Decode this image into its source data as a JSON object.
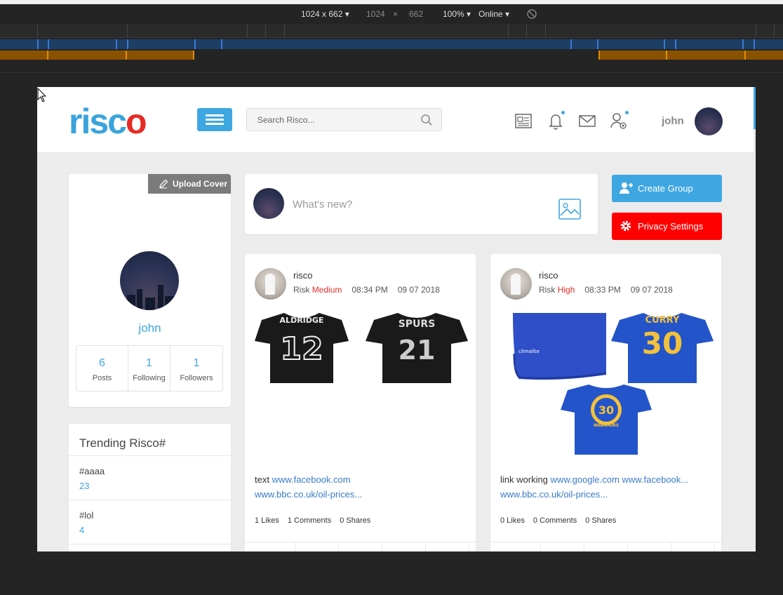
{
  "devtools": {
    "device": "1024 x 662",
    "width": "1024",
    "times": "×",
    "height": "662",
    "zoom": "100%",
    "network": "Online"
  },
  "header": {
    "logo_main": "risc",
    "logo_o": "o",
    "search_placeholder": "Search Risco...",
    "username": "john",
    "icons": [
      "news-icon",
      "bell-icon",
      "mail-icon",
      "add-user-icon"
    ]
  },
  "profile": {
    "upload_cover": "Upload Cover",
    "name": "john",
    "stats": [
      {
        "value": "6",
        "label": "Posts"
      },
      {
        "value": "1",
        "label": "Following"
      },
      {
        "value": "1",
        "label": "Followers"
      }
    ]
  },
  "trending": {
    "title": "Trending Risco#",
    "items": [
      {
        "tag": "#aaaa",
        "count": "23"
      },
      {
        "tag": "#lol",
        "count": "4"
      }
    ]
  },
  "composer": {
    "placeholder": "What's new?"
  },
  "actions": {
    "create_group": "Create Group",
    "privacy_settings": "Privacy Settings",
    "colors": {
      "create": "#3ea7e1",
      "privacy": "#ff0000"
    }
  },
  "posts": [
    {
      "author": "risco",
      "risk_label": "Risk",
      "risk_value": "Medium",
      "time": "08:34 PM",
      "date": "09 07 2018",
      "text": "text",
      "link1": "www.facebook.com",
      "link2": "www.bbc.co.uk/oil-prices...",
      "likes": "1 Likes",
      "comments": "1 Comments",
      "shares": "0 Shares",
      "images": [
        {
          "name": "ALDRIDGE",
          "number": "12"
        },
        {
          "name": "SPURS",
          "number": "21"
        }
      ]
    },
    {
      "author": "risco",
      "risk_label": "Risk",
      "risk_value": "High",
      "time": "08:33 PM",
      "date": "09 07 2018",
      "text": "link working",
      "link1": "www.google.com",
      "link2": "www.facebook...",
      "link3": "www.bbc.co.uk/oil-prices...",
      "likes": "0 Likes",
      "comments": "0 Comments",
      "shares": "0 Shares",
      "images": [
        {
          "name": "climalite",
          "number": ""
        },
        {
          "name": "CURRY",
          "number": "30"
        },
        {
          "name": "WARRIORS",
          "number": "30"
        }
      ]
    }
  ]
}
